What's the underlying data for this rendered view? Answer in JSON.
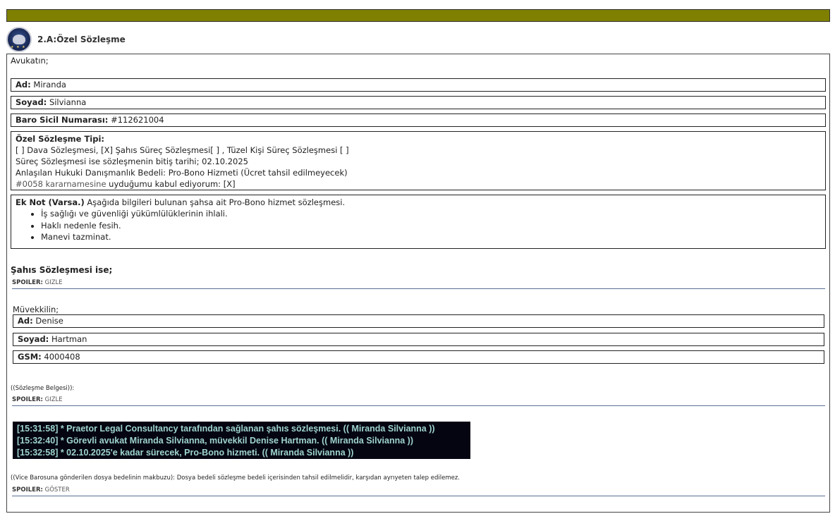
{
  "header": {
    "title": "2.A:Özel Sözleşme",
    "logo_icon": "bar-association-seal-icon",
    "bar_color": "#7f7f00"
  },
  "lawyer": {
    "intro": "Avukatın;",
    "first_name_label": "Ad:",
    "first_name": "Miranda",
    "last_name_label": "Soyad:",
    "last_name": "Silvianna",
    "bar_no_label": "Baro Sicil Numarası:",
    "bar_no": "#112621004"
  },
  "contract": {
    "type_label": "Özel Sözleşme Tipi:",
    "type_line": "[ ] Dava Sözleşmesi, [X] Şahıs Süreç Sözleşmesi[ ] , Tüzel Kişi Süreç Sözleşmesi [ ]",
    "end_date_line": "Süreç Sözleşmesi ise sözleşmenin bitiş tarihi; 02.10.2025",
    "fee_line": "Anlaşılan Hukuki Danışmanlık Bedeli: Pro-Bono Hizmeti (Ücret tahsil edilmeyecek)",
    "decree_link": "#0058 kararnamesine",
    "decree_rest": " uyduğumu kabul ediyorum: [X]"
  },
  "note": {
    "label": "Ek Not (Varsa.)",
    "text": " Aşağıda bilgileri bulunan şahsa ait Pro-Bono hizmet sözleşmesi.",
    "items": [
      "İş sağlığı ve güvenliği yükümlülüklerinin ihlali.",
      "Haklı nedenle fesih.",
      "Manevi tazminat."
    ]
  },
  "personal_section_title": "Şahıs Sözleşmesi ise;",
  "spoilers": [
    {
      "label": "SPOILER:",
      "action": "GIZLE"
    },
    {
      "label": "SPOILER:",
      "action": "GIZLE"
    },
    {
      "label": "SPOILER:",
      "action": "GÖSTER"
    }
  ],
  "client": {
    "intro": "Müvekkilin;",
    "first_name_label": "Ad:",
    "first_name": "Denise",
    "last_name_label": "Soyad:",
    "last_name": "Hartman",
    "gsm_label": "GSM:",
    "gsm": "4000408"
  },
  "document_caption": "((Sözleşme Belgesi)):",
  "chat_log": [
    "[15:31:58] * Praetor Legal Consultancy tarafından sağlanan şahıs sözleşmesi. (( Miranda Silvianna ))",
    "[15:32:40] * Görevli avukat Miranda Silvianna, müvekkil Denise Hartman. (( Miranda Silvianna ))",
    "[15:32:58] * 02.10.2025'e kadar sürecek, Pro-Bono hizmeti. (( Miranda Silvianna ))"
  ],
  "receipt_caption": "((Vice Barosuna gönderilen dosya bedelinin makbuzu): Dosya bedeli sözleşme bedeli içerisinden tahsil edilmelidir, karşıdan ayrıyeten talep edilemez."
}
